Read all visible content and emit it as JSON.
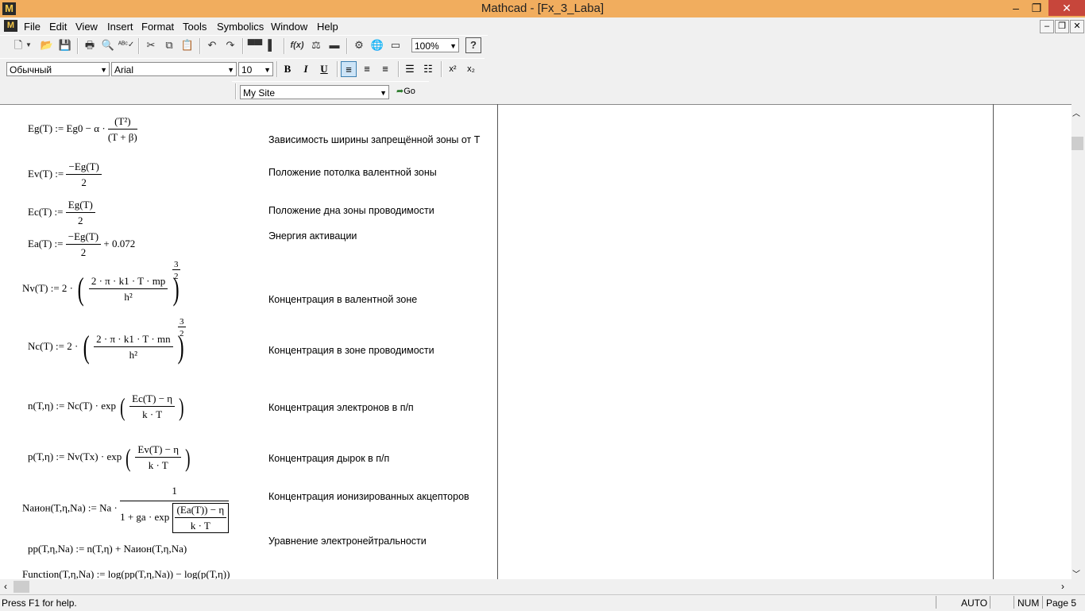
{
  "window": {
    "title": "Mathcad - [Fx_3_Laba]",
    "logo_letter": "M",
    "minimize": "–",
    "maximize": "❐",
    "close": "✕"
  },
  "menu": {
    "items": [
      "File",
      "Edit",
      "View",
      "Insert",
      "Format",
      "Tools",
      "Symbolics",
      "Window",
      "Help"
    ]
  },
  "toolbar": {
    "zoom": "100%",
    "help": "?",
    "fx": "f(x)"
  },
  "format_bar": {
    "style": "Обычный",
    "font": "Arial",
    "size": "10",
    "bold": "B",
    "italic": "I",
    "underline": "U",
    "superscript": "x²",
    "subscript": "x₂"
  },
  "web_bar": {
    "site": "My Site",
    "go": "Go"
  },
  "worksheet": {
    "comments": [
      "Зависимость ширины запрещённой зоны от T",
      "Положение потолка валентной зоны",
      "Положение дна зоны проводимости",
      "Энергия активации",
      "Концентрация в валентной зоне",
      "Концентрация в зоне проводимости",
      "Концентрация электронов в п/п",
      "Концентрация дырок в п/п",
      "Концентрация ионизированных акцепторов",
      "Уравнение электронейтральности"
    ],
    "eq": {
      "eg_lhs": "Eg(T) := Eg0 − α ·",
      "eg_num": "(T²)",
      "eg_den": "(T + β)",
      "ev_lhs": "Ev(T) :=",
      "ev_num": "−Eg(T)",
      "ev_den": "2",
      "ec_lhs": "Ec(T) :=",
      "ec_num": "Eg(T)",
      "ec_den": "2",
      "ea_lhs": "Ea(T) :=",
      "ea_num": "−Eg(T)",
      "ea_den": "2",
      "ea_tail": "+ 0.072",
      "nv_lhs": "Nv(T) := 2 ·",
      "nv_num": "2 · π · k1 · T · mp",
      "nv_den": "h²",
      "nc_lhs": "Nc(T) := 2 ·",
      "nc_num": "2 · π · k1 · T · mn",
      "nc_den": "h²",
      "pow_num": "3",
      "pow_den": "2",
      "n_lhs": "n(T,η) := Nc(T) · exp",
      "n_num": "Ec(T) − η",
      "n_den": "k · T",
      "p_lhs": "p(T,η) := Nv(Tx) · exp",
      "p_num": "Ev(T) − η",
      "p_den": "k · T",
      "na_lhs": "Naион(T,η,Na) := Na ·",
      "na_num": "1",
      "na_den_pre": "1 + ga · exp",
      "na_inner_num": "(Ea(T)) − η",
      "na_inner_den": "k · T",
      "pp": "pp(T,η,Na) := n(T,η) + Naион(T,η,Na)",
      "func": "Function(T,η,Na) := log(pp(T,η,Na)) − log(p(T,η))"
    }
  },
  "status": {
    "help": "Press F1 for help.",
    "mode": "AUTO",
    "num": "NUM",
    "page": "Page 5"
  }
}
